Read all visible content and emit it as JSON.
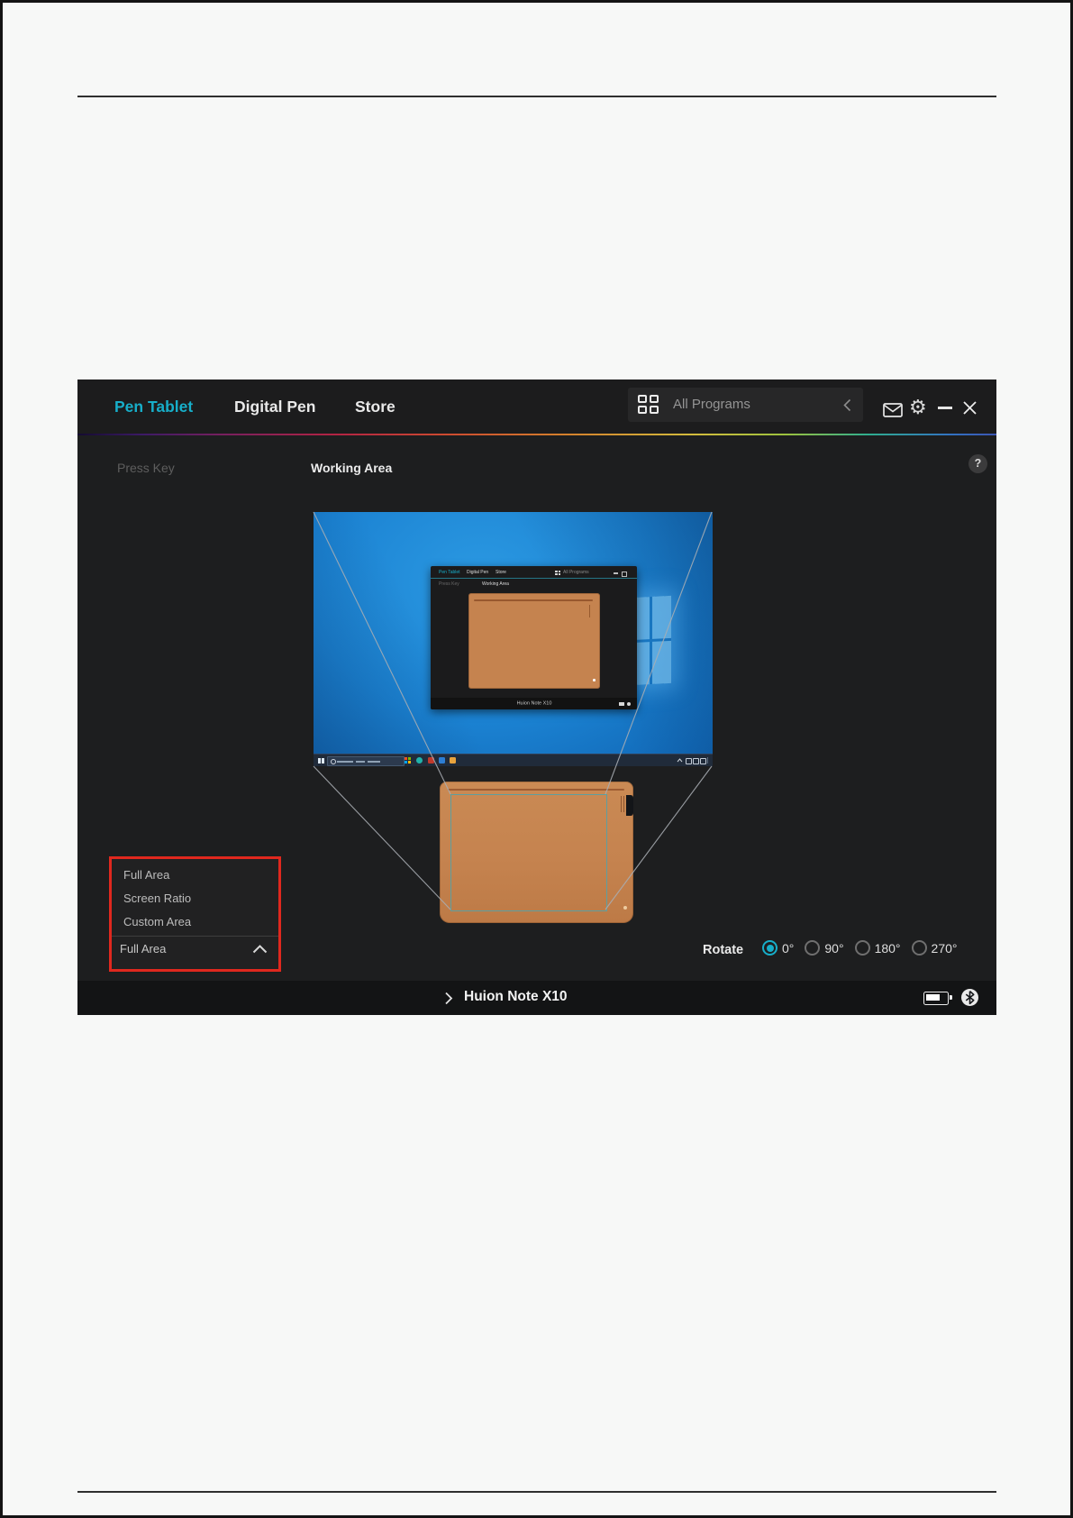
{
  "app": {
    "nav": {
      "tabs": [
        "Pen Tablet",
        "Digital Pen",
        "Store"
      ],
      "all_programs": "All Programs"
    },
    "subheader": {
      "press_key": "Press Key",
      "working_area": "Working Area",
      "help": "?"
    },
    "working_area_panel": {
      "dropdown": {
        "items": [
          "Full Area",
          "Screen Ratio",
          "Custom Area"
        ],
        "selected": "Full Area"
      },
      "rotate": {
        "label": "Rotate",
        "options": [
          "0°",
          "90°",
          "180°",
          "270°"
        ],
        "selected": "0°"
      }
    },
    "footer": {
      "device": "Huion Note X10"
    },
    "mini_window": {
      "tabs": [
        "Pen Tablet",
        "Digital Pen",
        "Store"
      ],
      "all_programs": "All Programs",
      "press_key": "Press Key",
      "working_area": "Working Area",
      "device": "Huion Note X10"
    },
    "colors": {
      "accent": "#17aec9",
      "highlight-red": "#e0281e",
      "tablet-orange": "#c5834f",
      "active-outline": "#5d9fa0"
    }
  }
}
